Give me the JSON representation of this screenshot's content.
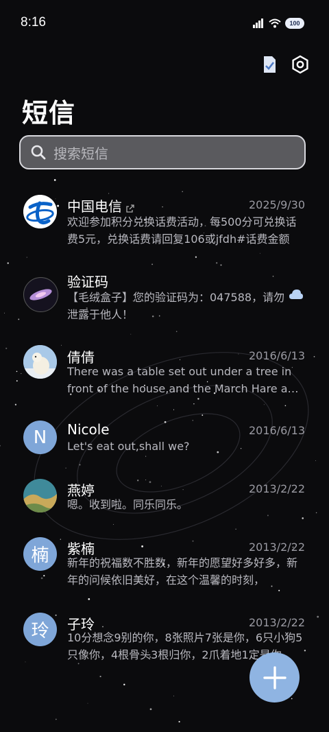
{
  "status_bar": {
    "time": "8:16",
    "battery": "100",
    "icons": [
      "signal-icon",
      "wifi-icon",
      "battery-icon"
    ]
  },
  "toolbar": {
    "icons": [
      "checklist-icon",
      "settings-icon"
    ]
  },
  "page_title": "短信",
  "search": {
    "placeholder": "搜索短信"
  },
  "conversations": [
    {
      "name": "中国电信",
      "date": "2025/9/30",
      "preview": "欢迎参加积分兑换话费活动，每500分可兑换话费5元，兑换话费请回复106或jfdh#话费金额",
      "avatar": "china-telecom-logo"
    },
    {
      "name": "验证码",
      "date": "",
      "preview": "【毛绒盒子】您的验证码为：047588，请勿泄露于他人！",
      "avatar": "galaxy-avatar",
      "badge_icon": "cloud-icon"
    },
    {
      "name": "倩倩",
      "date": "2016/6/13",
      "preview": "There was a table set out under a tree in front of the house,and the March Hare and the Hatter",
      "avatar": "polar-bear-photo"
    },
    {
      "name": "Nicole",
      "date": "2016/6/13",
      "preview": "Let's eat out,shall we?",
      "avatar_letter": "N"
    },
    {
      "name": "燕婷",
      "date": "2013/2/22",
      "preview": "嗯。收到啦。同乐同乐。",
      "avatar": "landscape-photo"
    },
    {
      "name": "紫楠",
      "date": "2013/2/22",
      "preview": "新年的祝福数不胜数，新年的愿望好多好多，新年的问候依旧美好，在这个温馨的时刻，",
      "avatar_letter": "楠"
    },
    {
      "name": "子玲",
      "date": "2013/2/22",
      "preview": "10分想念9别的你，8张照片7张是你，6只小狗5只像你，4根骨头3根归你，2爪着地1定是你",
      "avatar_letter": "玲"
    }
  ],
  "fab": {
    "icon": "plus-icon"
  },
  "colors": {
    "background": "#0b0b0d",
    "accent": "#8fb4e2",
    "avatar_letter_bg": "#7fa6d8"
  }
}
